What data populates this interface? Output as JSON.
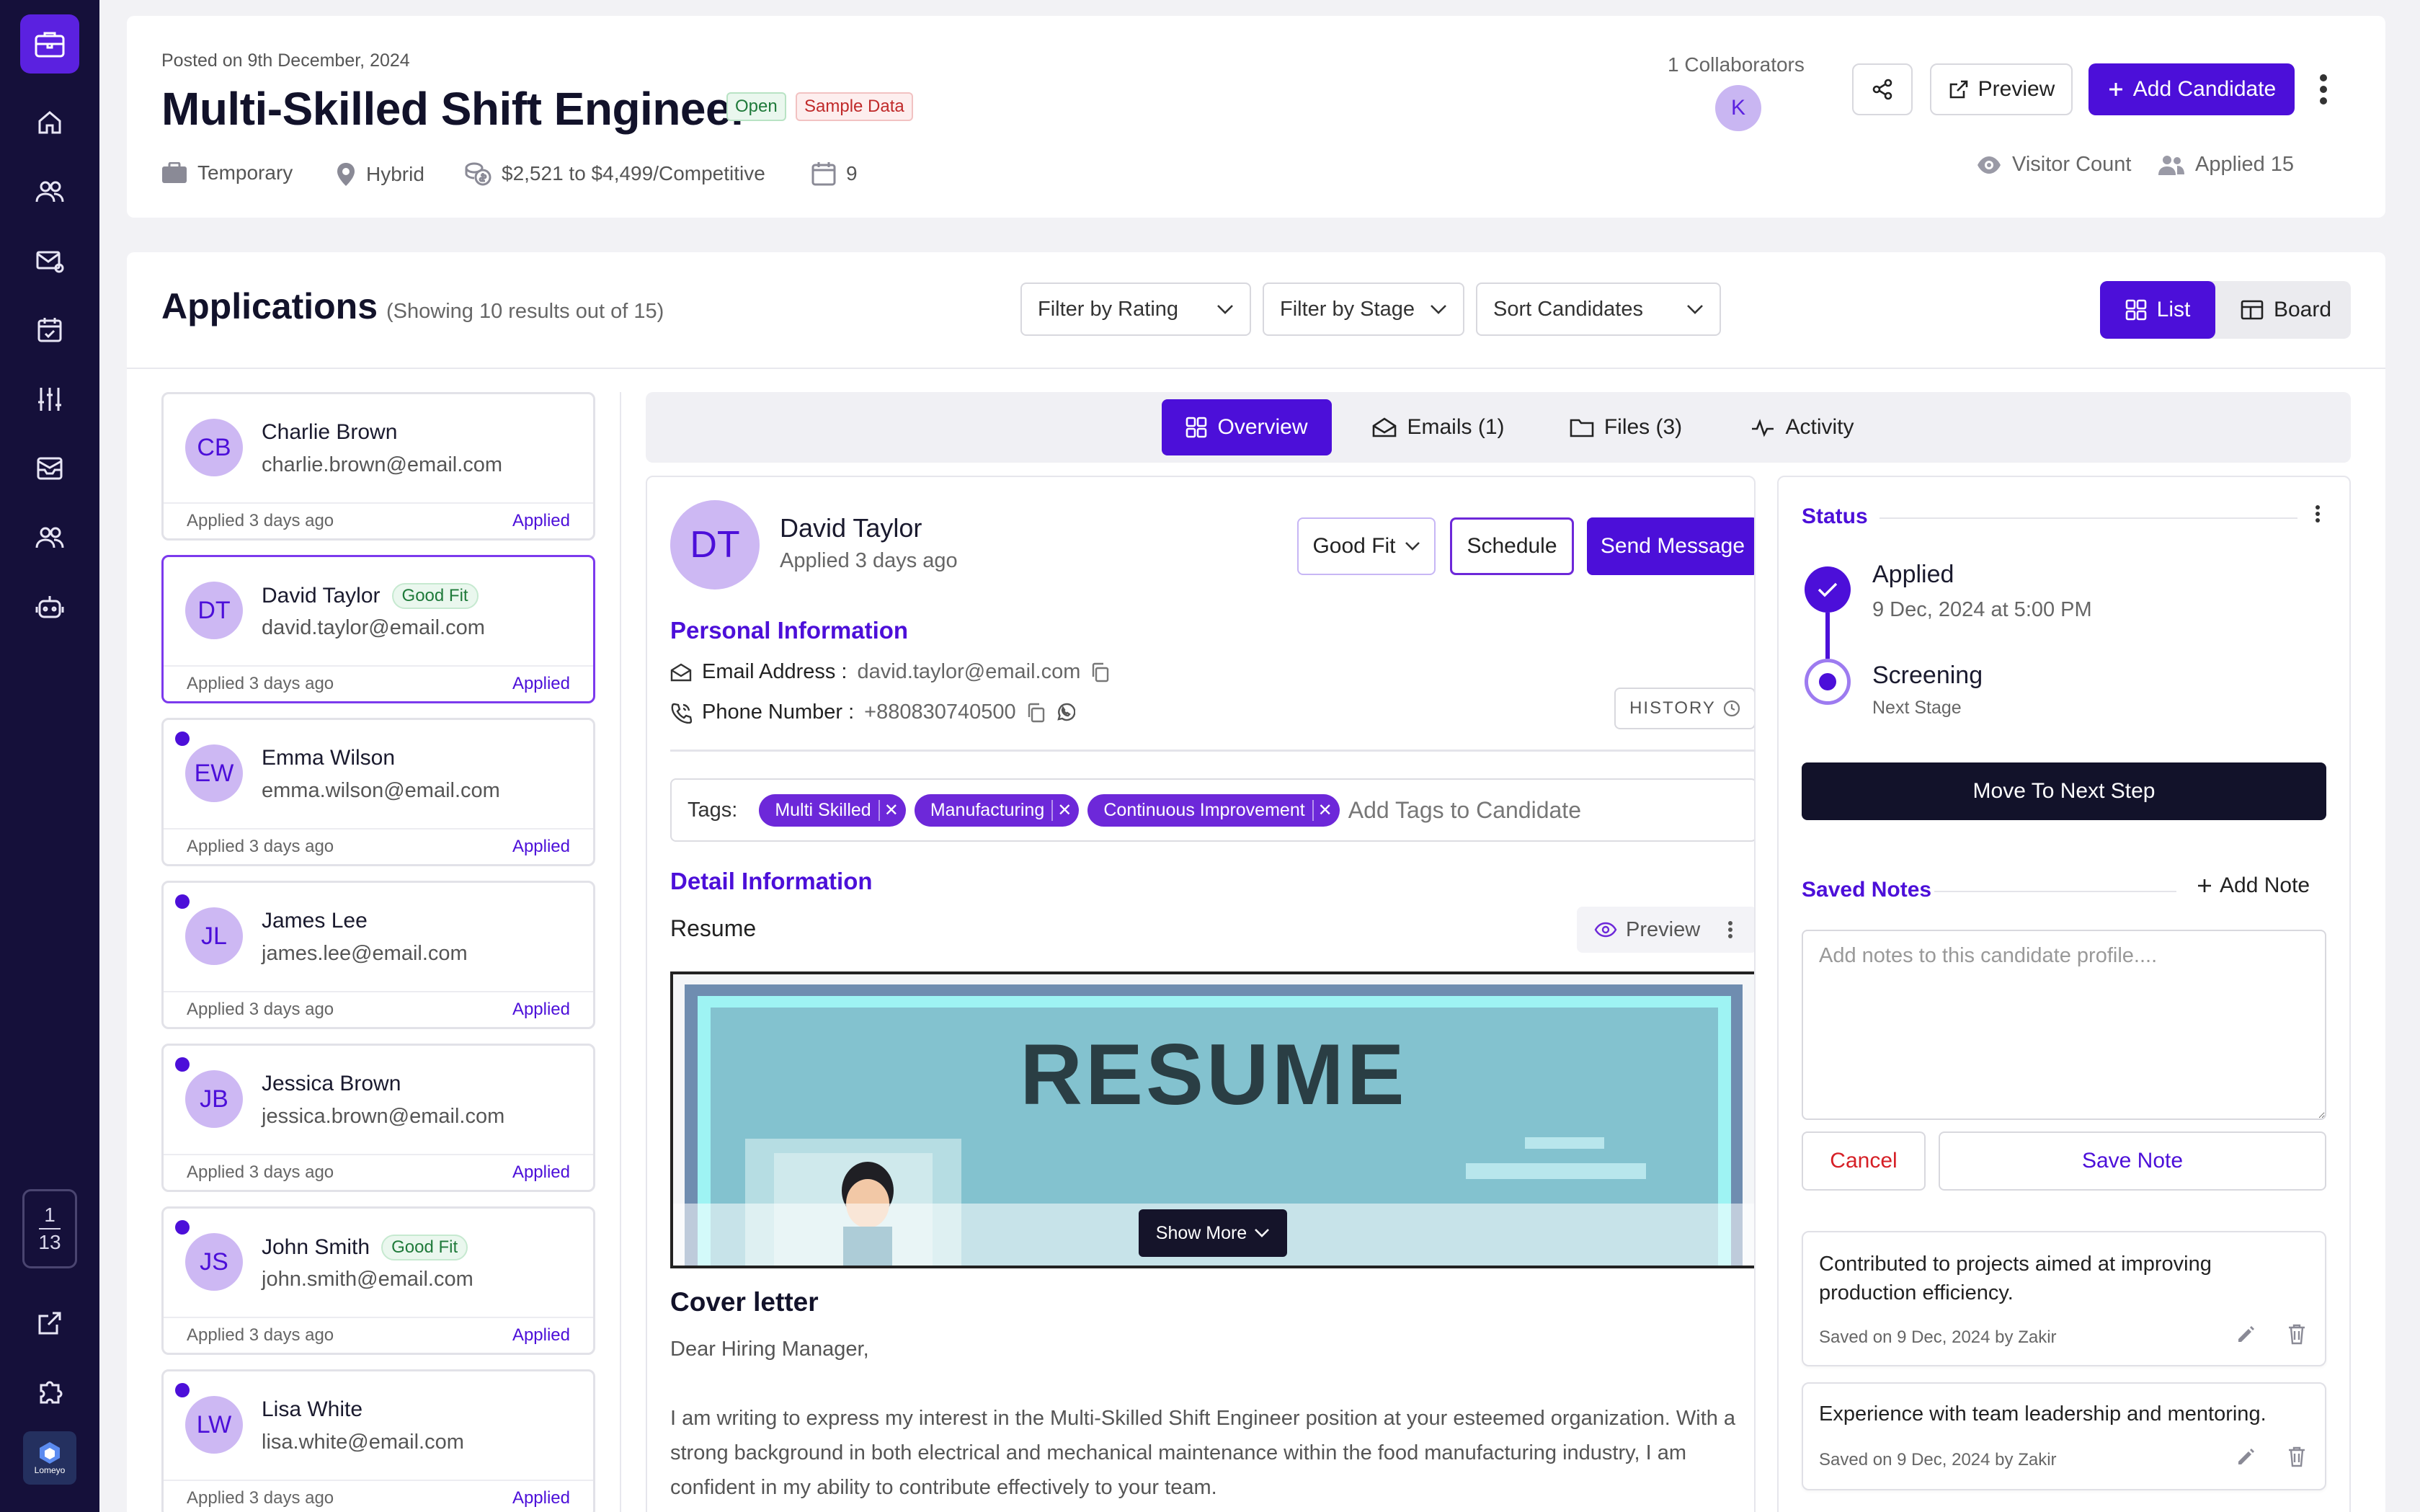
{
  "sidebar": {
    "items": [
      "home",
      "candidates",
      "mail",
      "tasks",
      "settings",
      "inbox",
      "team",
      "bot"
    ],
    "pager": {
      "current": "1",
      "total": "13"
    },
    "brand": "Lomeyo"
  },
  "job": {
    "posted": "Posted on 9th December, 2024",
    "title": "Multi-Skilled Shift Engineer",
    "status_badge": "Open",
    "sample_badge": "Sample Data",
    "employment_type": "Temporary",
    "work_mode": "Hybrid",
    "salary": "$2,521 to $4,499/Competitive",
    "openings": "9",
    "collaborators_label": "1 Collaborators",
    "collaborator_initial": "K",
    "preview_label": "Preview",
    "add_candidate_label": "Add Candidate",
    "visitor_label": "Visitor Count",
    "applied_label": "Applied 15"
  },
  "applications": {
    "title": "Applications",
    "subtitle": "(Showing 10 results out of 15)",
    "filter_rating": "Filter by Rating",
    "filter_stage": "Filter by Stage",
    "sort": "Sort Candidates",
    "view_list": "List",
    "view_board": "Board"
  },
  "candidates": [
    {
      "initials": "CB",
      "name": "Charlie Brown",
      "email": "charlie.brown@email.com",
      "applied": "Applied 3 days ago",
      "status": "Applied",
      "badge": "",
      "unread": false,
      "selected": false
    },
    {
      "initials": "DT",
      "name": "David Taylor",
      "email": "david.taylor@email.com",
      "applied": "Applied 3 days ago",
      "status": "Applied",
      "badge": "Good Fit",
      "unread": false,
      "selected": true
    },
    {
      "initials": "EW",
      "name": "Emma Wilson",
      "email": "emma.wilson@email.com",
      "applied": "Applied 3 days ago",
      "status": "Applied",
      "badge": "",
      "unread": true,
      "selected": false
    },
    {
      "initials": "JL",
      "name": "James Lee",
      "email": "james.lee@email.com",
      "applied": "Applied 3 days ago",
      "status": "Applied",
      "badge": "",
      "unread": true,
      "selected": false
    },
    {
      "initials": "JB",
      "name": "Jessica Brown",
      "email": "jessica.brown@email.com",
      "applied": "Applied 3 days ago",
      "status": "Applied",
      "badge": "",
      "unread": true,
      "selected": false
    },
    {
      "initials": "JS",
      "name": "John Smith",
      "email": "john.smith@email.com",
      "applied": "Applied 3 days ago",
      "status": "Applied",
      "badge": "Good Fit",
      "unread": true,
      "selected": false
    },
    {
      "initials": "LW",
      "name": "Lisa White",
      "email": "lisa.white@email.com",
      "applied": "Applied 3 days ago",
      "status": "Applied",
      "badge": "",
      "unread": true,
      "selected": false
    }
  ],
  "tabs": {
    "overview": "Overview",
    "emails": "Emails (1)",
    "files": "Files (3)",
    "activity": "Activity"
  },
  "detail": {
    "initials": "DT",
    "name": "David Taylor",
    "applied": "Applied 3 days ago",
    "fit_select": "Good Fit",
    "schedule": "Schedule",
    "send_message": "Send Message",
    "personal_title": "Personal Information",
    "email_label": "Email Address :",
    "email_value": "david.taylor@email.com",
    "phone_label": "Phone Number :",
    "phone_value": "+880830740500",
    "history": "HISTORY",
    "tags_label": "Tags:",
    "tags": [
      "Multi Skilled",
      "Manufacturing",
      "Continuous Improvement"
    ],
    "tags_placeholder": "Add Tags to Candidate",
    "detail_title": "Detail Information",
    "resume_label": "Resume",
    "resume_preview": "Preview",
    "resume_heading": "RESUME",
    "show_more": "Show More",
    "cover_title": "Cover letter",
    "cover_greeting": "Dear Hiring Manager,",
    "cover_body": "I am writing to express my interest in the Multi-Skilled Shift Engineer position at your esteemed organization. With a strong background in both electrical and mechanical maintenance within the food manufacturing industry, I am confident in my ability to contribute effectively to your team."
  },
  "status": {
    "title": "Status",
    "step1_title": "Applied",
    "step1_sub": "9 Dec, 2024 at 5:00 PM",
    "step2_title": "Screening",
    "step2_sub": "Next Stage",
    "move_button": "Move To Next Step",
    "notes_title": "Saved Notes",
    "add_note": "Add Note",
    "notes_placeholder": "Add notes to this candidate profile....",
    "cancel": "Cancel",
    "save": "Save Note",
    "notes": [
      {
        "text": "Contributed to projects aimed at improving production efficiency.",
        "by": "Saved on 9 Dec, 2024 by Zakir"
      },
      {
        "text": "Experience with team leadership and mentoring.",
        "by": "Saved on 9 Dec, 2024 by Zakir"
      }
    ]
  },
  "colors": {
    "accent": "#4c0fd9",
    "sidebar": "#15103a",
    "avatar_bg": "#cdb8f3",
    "success": "#1f7a3a",
    "danger": "#d61f26"
  }
}
